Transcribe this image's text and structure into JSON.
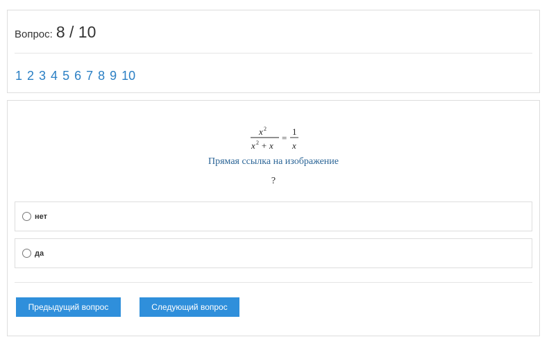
{
  "header": {
    "question_label": "Вопрос:",
    "question_counter": "8 / 10",
    "question_numbers": [
      "1",
      "2",
      "3",
      "4",
      "5",
      "6",
      "7",
      "8",
      "9",
      "10"
    ]
  },
  "question": {
    "formula": {
      "left_numerator": "x",
      "left_numerator_exp": "2",
      "left_denominator": "x",
      "left_denominator_exp": "2",
      "left_denominator_rest": "+ x",
      "equals": "=",
      "right_numerator": "1",
      "right_denominator": "x"
    },
    "image_link_text": "Прямая ссылка на изображение",
    "question_mark": "?",
    "answers": [
      {
        "label": "нет",
        "selected": false
      },
      {
        "label": "да",
        "selected": false
      }
    ]
  },
  "buttons": {
    "prev_label": "Предыдущий вопрос",
    "next_label": "Следующий вопрос"
  },
  "colors": {
    "link": "#2a7fc4",
    "button_bg": "#2f8fdb",
    "border": "#dddddd"
  }
}
